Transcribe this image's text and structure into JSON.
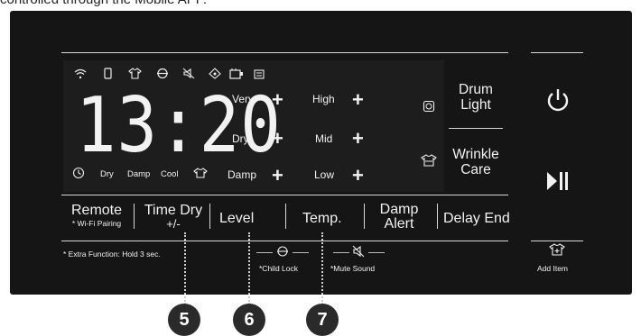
{
  "caption": "controlled through the Mobile APP.",
  "display": {
    "time": "13:20",
    "left_labels": [
      "Dry",
      "Damp",
      "Cool"
    ],
    "level_rows": [
      "Very",
      "Dry",
      "Damp"
    ],
    "temp_rows": [
      "High",
      "Mid",
      "Low"
    ],
    "plus": "+"
  },
  "right_buttons": {
    "drum_light": [
      "Drum",
      "Light"
    ],
    "wrinkle_care": [
      "Wrinkle",
      "Care"
    ]
  },
  "bottom_buttons": {
    "remote": "Remote",
    "remote_sub": "* Wi-Fi Pairing",
    "time_dry": "Time Dry",
    "time_dry_sub": "+/-",
    "level": "Level",
    "temp": "Temp.",
    "damp_alert": [
      "Damp",
      "Alert"
    ],
    "delay_end": "Delay End"
  },
  "notes": {
    "extra_function": "* Extra Function: Hold 3 sec.",
    "child_lock": "*Child Lock",
    "mute_sound": "*Mute Sound",
    "add_item": "Add Item"
  },
  "callouts": [
    "5",
    "6",
    "7"
  ],
  "icons": [
    "wifi-icon",
    "phone-icon",
    "shirt-icon",
    "child-lock-icon",
    "mute-icon",
    "dry-sensor-icon",
    "drum-icon",
    "filter-icon",
    "clock-icon",
    "wrinkle-icon",
    "power-icon",
    "play-pause-icon",
    "add-item-icon"
  ]
}
